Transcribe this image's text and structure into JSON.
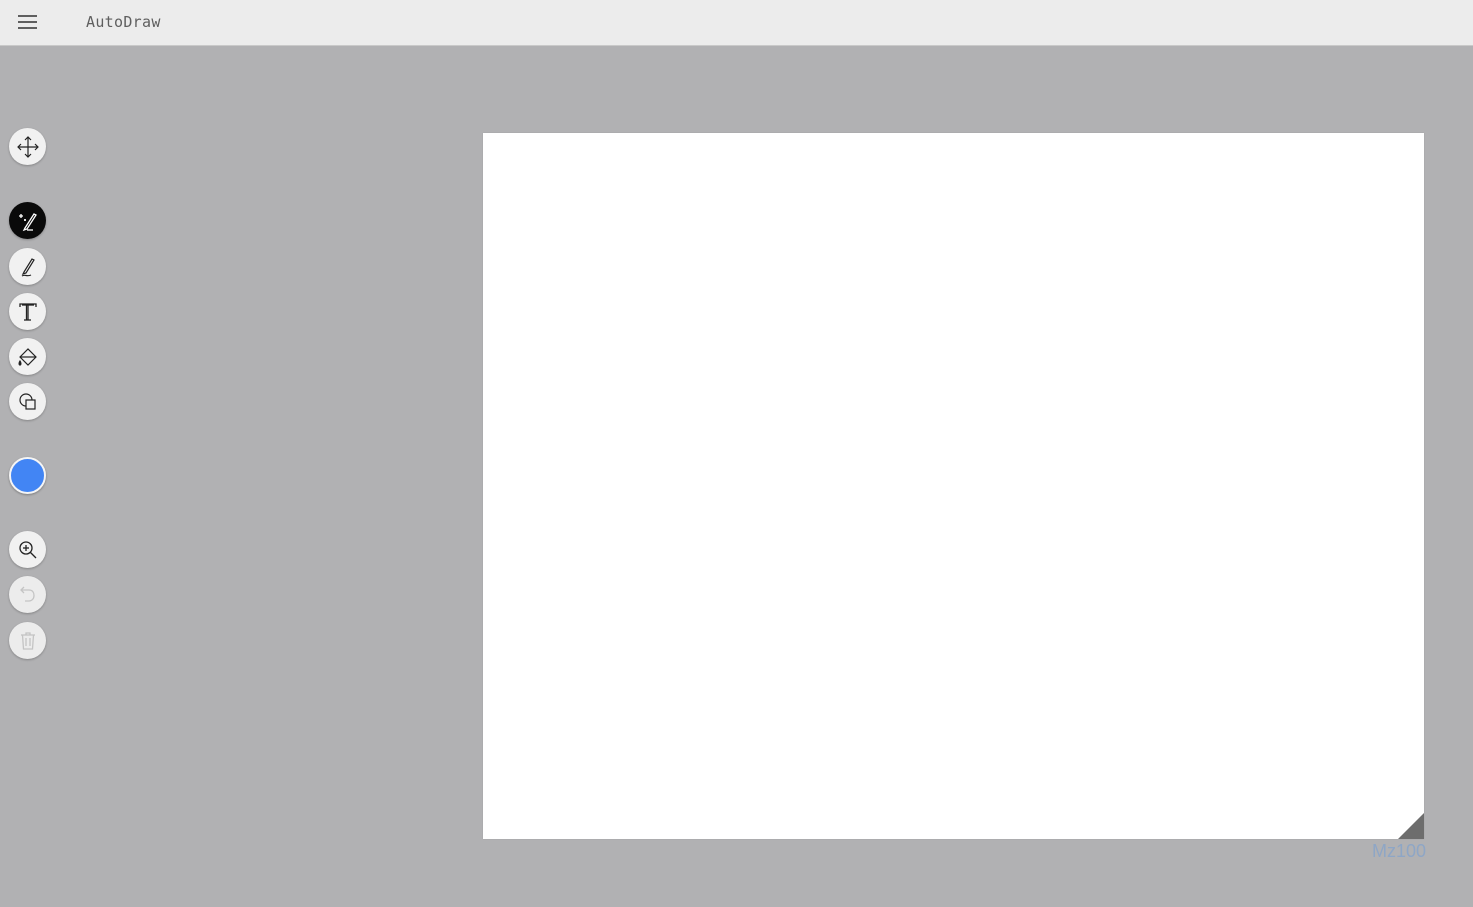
{
  "header": {
    "app_title": "AutoDraw"
  },
  "toolbar": {
    "tools": [
      {
        "name": "move",
        "icon": "move-arrows-icon",
        "state": "normal"
      },
      {
        "name": "autodraw",
        "icon": "autodraw-wand-icon",
        "state": "active"
      },
      {
        "name": "draw",
        "icon": "pencil-icon",
        "state": "normal"
      },
      {
        "name": "type",
        "icon": "text-icon",
        "state": "normal"
      },
      {
        "name": "fill",
        "icon": "paint-bucket-icon",
        "state": "normal"
      },
      {
        "name": "shape",
        "icon": "shapes-icon",
        "state": "normal"
      },
      {
        "name": "color",
        "icon": "color-swatch",
        "state": "normal"
      },
      {
        "name": "zoom",
        "icon": "zoom-in-icon",
        "state": "normal"
      },
      {
        "name": "undo",
        "icon": "undo-icon",
        "state": "disabled"
      },
      {
        "name": "delete",
        "icon": "trash-icon",
        "state": "disabled"
      }
    ],
    "selected_color": "#4285f4"
  },
  "canvas": {
    "background": "#ffffff"
  },
  "watermark": {
    "text": "Mz100"
  },
  "colors": {
    "topbar": "#ececec",
    "workspace": "#b1b1b3",
    "active_tool": "#0a0a0a",
    "accent": "#4285f4"
  }
}
